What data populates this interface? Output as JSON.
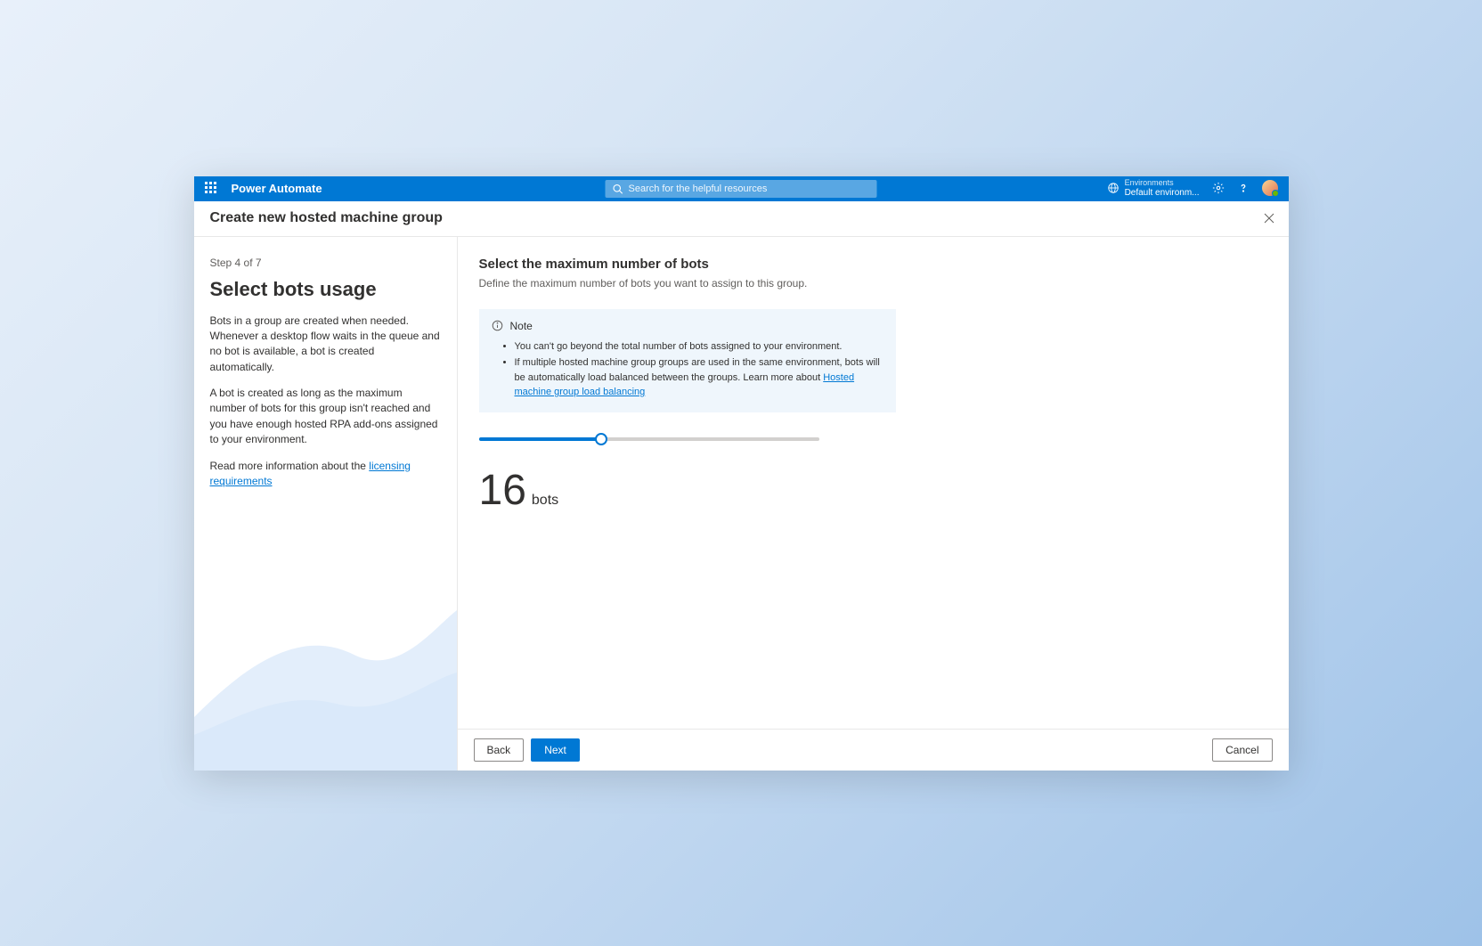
{
  "header": {
    "app_name": "Power Automate",
    "search_placeholder": "Search for the helpful resources",
    "env_label": "Environments",
    "env_name": "Default environm..."
  },
  "title": "Create new hosted machine group",
  "sidebar": {
    "step": "Step 4 of 7",
    "heading": "Select bots usage",
    "para1": "Bots in a group are created when needed. Whenever a desktop flow waits in the queue and no bot is available, a bot is created automatically.",
    "para2": "A bot is created as long as the maximum number of bots for this group isn't reached and you have enough hosted RPA add-ons assigned to your environment.",
    "para3_prefix": "Read more information about the ",
    "para3_link": "licensing requirements"
  },
  "content": {
    "heading": "Select the maximum number of bots",
    "subheading": "Define the maximum number of bots you want to assign to this group.",
    "note_title": "Note",
    "note_item1": "You can't go beyond the total number of bots assigned to your environment.",
    "note_item2_prefix": "If multiple hosted machine group groups are used in the same environment, bots will be automatically load balanced between the groups. Learn more about ",
    "note_item2_link": "Hosted machine group load balancing",
    "bot_count": "16",
    "bot_unit": "bots"
  },
  "footer": {
    "back": "Back",
    "next": "Next",
    "cancel": "Cancel"
  }
}
